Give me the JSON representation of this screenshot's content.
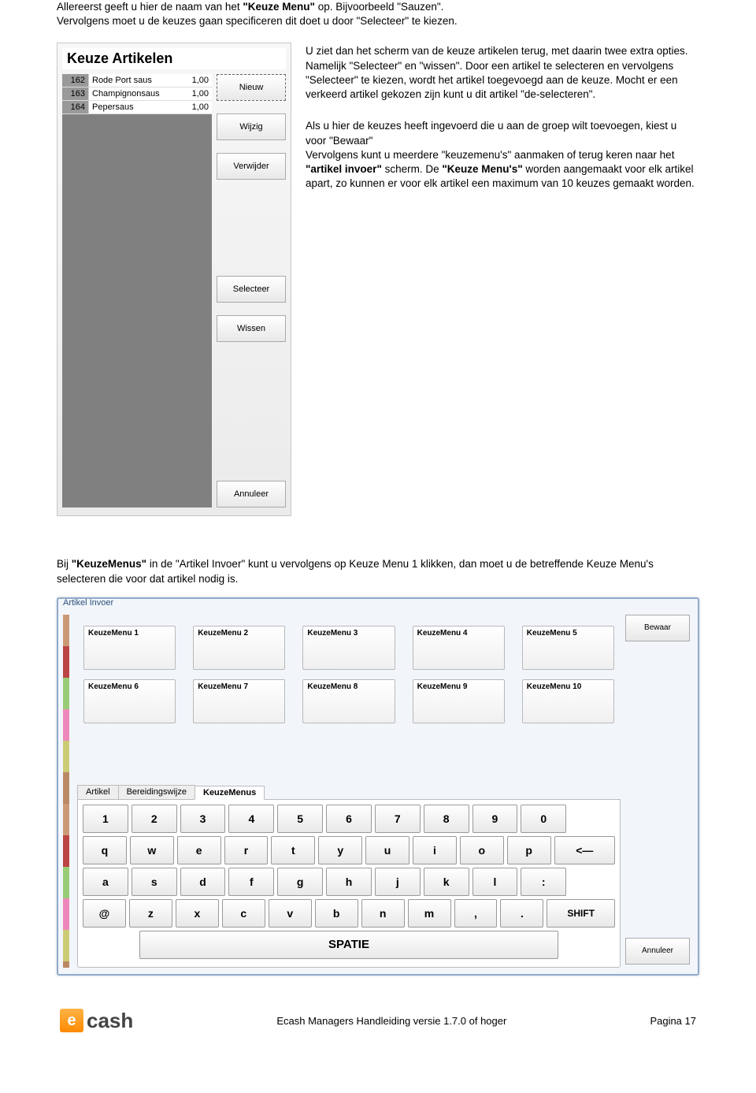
{
  "intro": {
    "line1a": "Allereerst geeft u hier de naam van het ",
    "bold1": "\"Keuze Menu\"",
    "line1b": " op. Bijvoorbeeld \"Sauzen\".",
    "line2": "Vervolgens moet u de keuzes gaan specificeren dit doet u door \"Selecteer\" te kiezen."
  },
  "keuzeArtikelen": {
    "title": "Keuze Artikelen",
    "rows": [
      {
        "id": "162",
        "name": "Rode Port saus",
        "val": "1,00"
      },
      {
        "id": "163",
        "name": "Champignonsaus",
        "val": "1,00"
      },
      {
        "id": "164",
        "name": "Pepersaus",
        "val": "1,00"
      }
    ],
    "buttons": {
      "nieuw": "Nieuw",
      "wijzig": "Wijzig",
      "verwijder": "Verwijder",
      "selecteer": "Selecteer",
      "wissen": "Wissen",
      "annuleer": "Annuleer"
    }
  },
  "para1": "U ziet dan het scherm van de keuze artikelen terug, met daarin twee extra opties. Namelijk \"Selecteer\" en \"wissen\". Door een artikel te selecteren en vervolgens  \"Selecteer\" te kiezen, wordt het artikel toegevoegd aan de keuze. Mocht er een verkeerd artikel gekozen zijn kunt u dit artikel \"de-selecteren\".",
  "para2a": "Als u hier de keuzes heeft ingevoerd die u aan de groep wilt toevoegen, kiest u voor \"Bewaar\"",
  "para2b": "Vervolgens kunt u meerdere \"keuzemenu's\" aanmaken of terug keren naar het ",
  "para2bold1": "\"artikel invoer\"",
  "para2c": " scherm. De ",
  "para2bold2": "\"Keuze Menu's\"",
  "para2d": " worden aangemaakt voor elk artikel apart, zo kunnen er voor elk artikel een maximum van 10 keuzes gemaakt worden.",
  "midText": {
    "a": "Bij ",
    "bold": "\"KeuzeMenus\"",
    "b": " in de \"Artikel Invoer\" kunt u vervolgens op Keuze Menu 1 klikken, dan moet u de betreffende Keuze Menu's selecteren die voor dat artikel nodig is."
  },
  "artikelInvoer": {
    "title": "Artikel Invoer",
    "menus": [
      "KeuzeMenu 1",
      "KeuzeMenu 2",
      "KeuzeMenu 3",
      "KeuzeMenu 4",
      "KeuzeMenu 5",
      "KeuzeMenu 6",
      "KeuzeMenu 7",
      "KeuzeMenu 8",
      "KeuzeMenu 9",
      "KeuzeMenu 10"
    ],
    "tabs": {
      "artikel": "Artikel",
      "bereiding": "Bereidingswijze",
      "keuzemenus": "KeuzeMenus"
    },
    "bewaar": "Bewaar",
    "annuleer": "Annuleer",
    "keyboard": {
      "row1": [
        "1",
        "2",
        "3",
        "4",
        "5",
        "6",
        "7",
        "8",
        "9",
        "0"
      ],
      "row2": [
        "q",
        "w",
        "e",
        "r",
        "t",
        "y",
        "u",
        "i",
        "o",
        "p",
        "<—"
      ],
      "row3": [
        "a",
        "s",
        "d",
        "f",
        "g",
        "h",
        "j",
        "k",
        "l",
        ":"
      ],
      "row4": [
        "@",
        "z",
        "x",
        "c",
        "v",
        "b",
        "n",
        "m",
        ",",
        ".",
        "SHIFT"
      ],
      "space": "SPATIE"
    }
  },
  "footer": {
    "logoText": "cash",
    "center": "Ecash Managers Handleiding versie 1.7.0 of hoger",
    "right": "Pagina 17"
  }
}
